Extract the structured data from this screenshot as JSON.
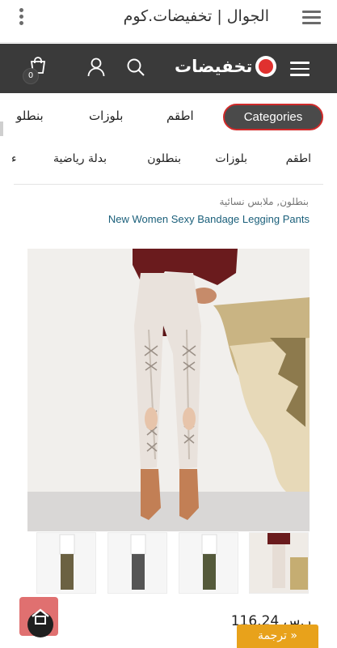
{
  "app_bar": {
    "title": "الجوال | تخفيضات.كوم"
  },
  "header": {
    "logo_text": "تخفيضات",
    "cart_count": "0"
  },
  "tabs": {
    "active": "Categories",
    "items": [
      "اطقم",
      "بلوزات",
      "بنطلو"
    ]
  },
  "subnav": {
    "items": [
      "اطقم",
      "بلوزات",
      "بنطلون",
      "بدلة رياضية",
      "ء"
    ]
  },
  "product": {
    "categories": "بنطلون, ملابس نسائية",
    "name": "New Women Sexy Bandage Legging Pants",
    "price": "116.24 ر.س"
  },
  "translate_button": "ترجمة »",
  "colors": {
    "header_bg": "#3a3a3a",
    "accent_red": "#d02a2a",
    "link": "#1a5f7a",
    "translate_bg": "#e8a21b"
  },
  "icons": [
    "kebab-menu-icon",
    "hamburger-icon",
    "cart-icon",
    "user-icon",
    "search-icon",
    "home-icon"
  ]
}
